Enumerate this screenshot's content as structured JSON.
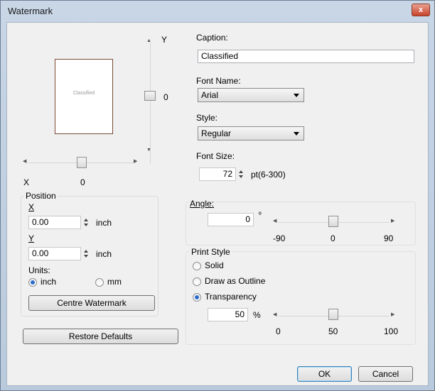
{
  "window": {
    "title": "Watermark",
    "close_glyph": "x"
  },
  "preview": {
    "text": "Classified",
    "y_label": "Y",
    "y_value": "0",
    "x_label": "X",
    "x_value": "0",
    "up_arrow": "▲",
    "down_arrow": "▼",
    "left_arrow": "◀",
    "right_arrow": "▶"
  },
  "position": {
    "group_label": "Position",
    "x_label": "X",
    "x_value": "0.00",
    "x_unit": "inch",
    "y_label": "Y",
    "y_value": "0.00",
    "y_unit": "inch",
    "units_label": "Units:",
    "unit_inch": "inch",
    "unit_mm": "mm",
    "selected_unit": "inch",
    "centre_button": "Centre Watermark"
  },
  "restore_button": "Restore Defaults",
  "caption": {
    "label": "Caption:",
    "value": "Classified"
  },
  "font_name": {
    "label": "Font Name:",
    "value": "Arial"
  },
  "style": {
    "label": "Style:",
    "value": "Regular"
  },
  "font_size": {
    "label": "Font Size:",
    "value": "72",
    "range_label": "pt(6-300)"
  },
  "angle": {
    "label": "Angle:",
    "value": "0",
    "degree_symbol": "º",
    "slider_min": "-90",
    "slider_mid": "0",
    "slider_max": "90",
    "slider_value": 0
  },
  "print_style": {
    "label": "Print Style",
    "options": [
      "Solid",
      "Draw as Outline",
      "Transparency"
    ],
    "selected": "Transparency",
    "transparency_value": "50",
    "percent": "%",
    "slider_min": "0",
    "slider_mid": "50",
    "slider_max": "100",
    "slider_value": 50
  },
  "buttons": {
    "ok": "OK",
    "cancel": "Cancel"
  }
}
